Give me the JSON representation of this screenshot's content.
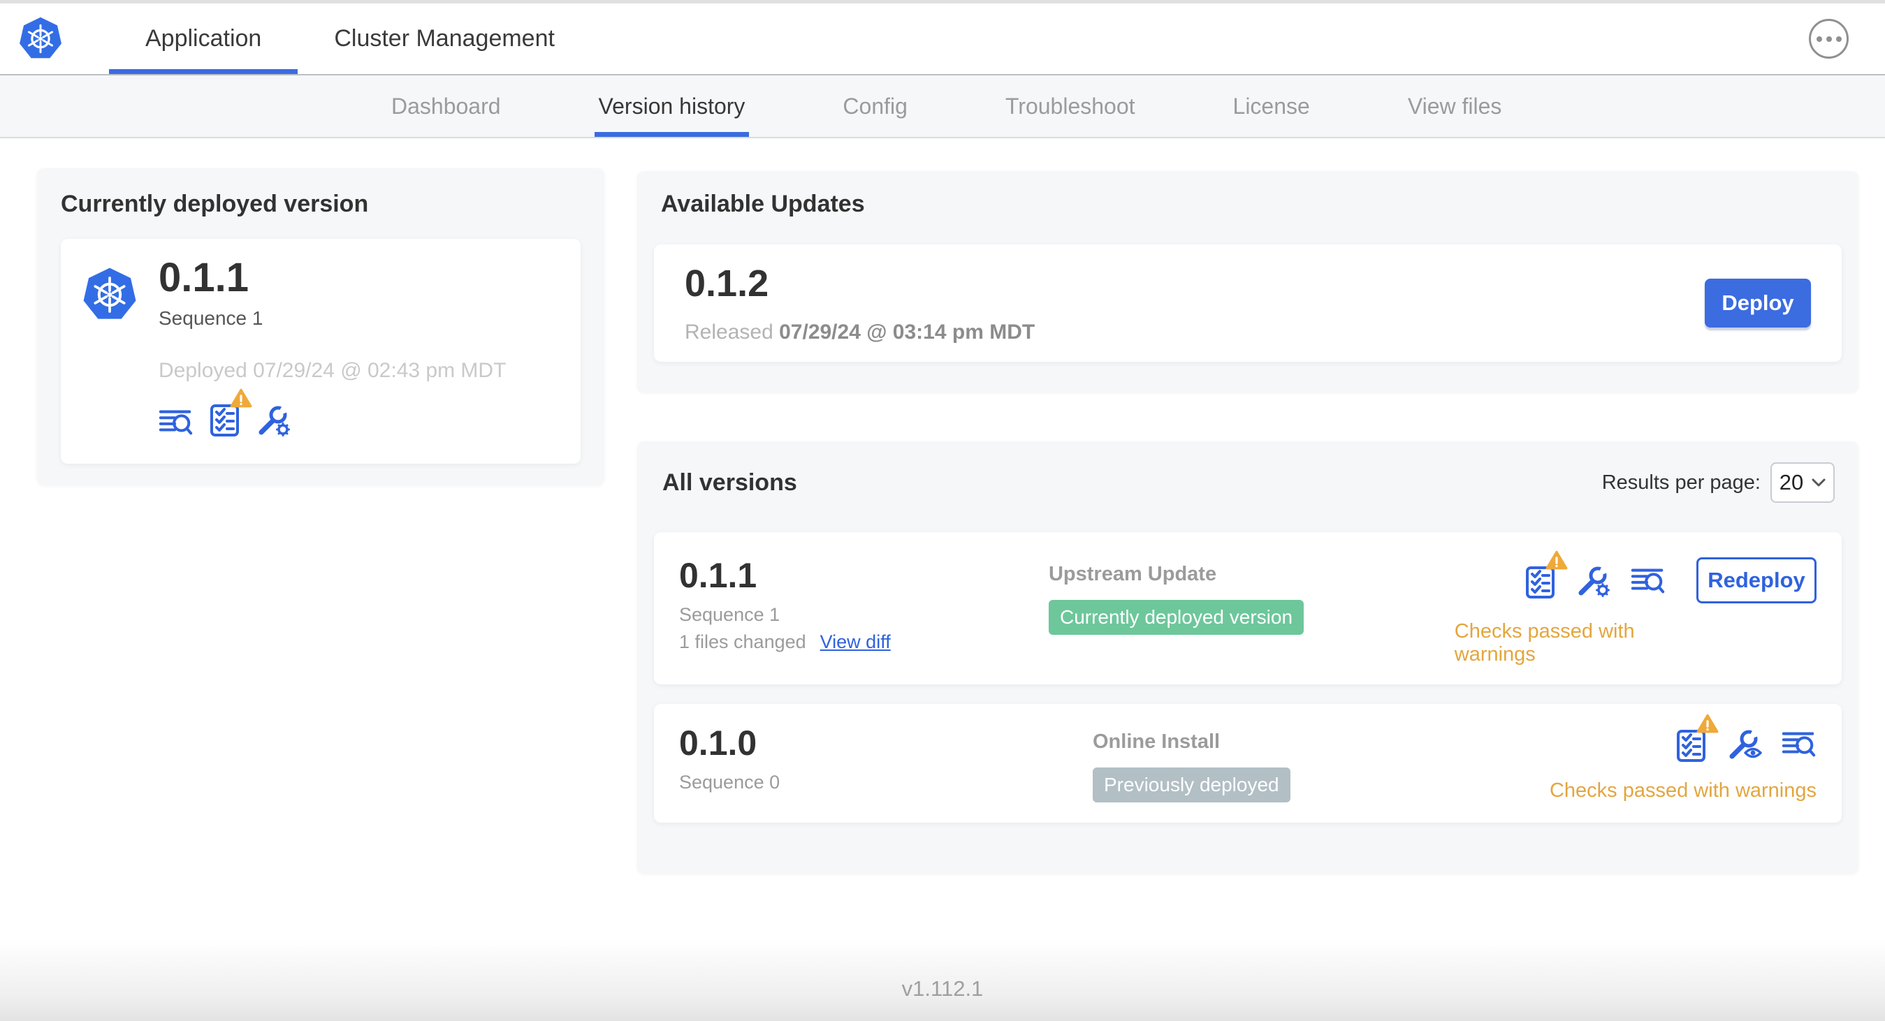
{
  "colors": {
    "accent_blue": "#3b6ce0",
    "icon_blue": "#2f62de",
    "badge_green": "#6dc79b",
    "badge_gray": "#b2bfc5",
    "warning_orange": "#e3a63e"
  },
  "icons": {
    "brand": "kubernetes-logo",
    "menu": "ellipsis-icon",
    "logs": "view-logs-icon",
    "preflight": "preflight-checks-icon",
    "preflight_warning": "warning-triangle-icon",
    "edit_config": "wrench-gear-icon",
    "view_config": "wrench-eye-icon",
    "select_chevron": "chevron-down-icon"
  },
  "header": {
    "tabs": [
      {
        "label": "Application"
      },
      {
        "label": "Cluster Management"
      }
    ]
  },
  "subnav": {
    "tabs": [
      "Dashboard",
      "Version history",
      "Config",
      "Troubleshoot",
      "License",
      "View files"
    ]
  },
  "deployed_card": {
    "title": "Currently deployed version",
    "version": "0.1.1",
    "sequence": "Sequence 1",
    "deployed": "Deployed 07/29/24 @ 02:43 pm MDT"
  },
  "available_updates": {
    "title": "Available Updates",
    "version": "0.1.2",
    "released_label": "Released",
    "released_date": "07/29/24 @ 03:14 pm MDT",
    "deploy_label": "Deploy"
  },
  "all_versions": {
    "title": "All versions",
    "results_label": "Results per page:",
    "results_value": "20",
    "rows": [
      {
        "version": "0.1.1",
        "sequence": "Sequence 1",
        "files_changed": "1 files changed",
        "view_diff": "View diff",
        "source": "Upstream Update",
        "badge": "Currently deployed version",
        "checks": "Checks passed with warnings",
        "button": "Redeploy"
      },
      {
        "version": "0.1.0",
        "sequence": "Sequence 0",
        "source": "Online Install",
        "badge": "Previously deployed",
        "checks": "Checks passed with warnings"
      }
    ]
  },
  "footer": {
    "version": "v1.112.1"
  }
}
